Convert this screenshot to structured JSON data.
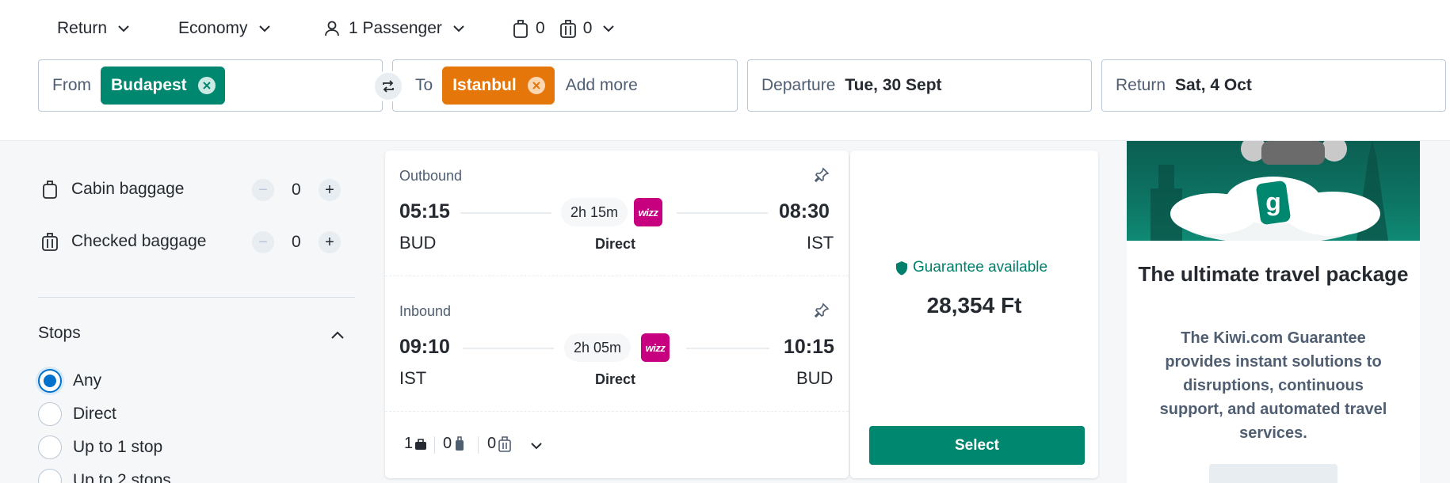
{
  "options": {
    "trip_type": "Return",
    "cabin_class": "Economy",
    "passengers": "1 Passenger",
    "cabin_bags": "0",
    "checked_bags": "0"
  },
  "search": {
    "from_label": "From",
    "from_value": "Budapest",
    "to_label": "To",
    "to_value": "Istanbul",
    "add_more": "Add more",
    "departure_label": "Departure",
    "departure_value": "Tue, 30 Sept",
    "return_label": "Return",
    "return_value": "Sat, 4 Oct"
  },
  "sidebar": {
    "cabin_baggage_label": "Cabin baggage",
    "cabin_baggage_count": "0",
    "checked_baggage_label": "Checked baggage",
    "checked_baggage_count": "0",
    "stops_title": "Stops",
    "stops_options": [
      "Any",
      "Direct",
      "Up to 1 stop",
      "Up to 2 stops"
    ],
    "stops_selected": "Any"
  },
  "result": {
    "outbound": {
      "label": "Outbound",
      "depart_time": "05:15",
      "arrive_time": "08:30",
      "duration": "2h 15m",
      "from_code": "BUD",
      "to_code": "IST",
      "stops": "Direct",
      "airline_logo": "wizz"
    },
    "inbound": {
      "label": "Inbound",
      "depart_time": "09:10",
      "arrive_time": "10:15",
      "duration": "2h 05m",
      "from_code": "IST",
      "to_code": "BUD",
      "stops": "Direct",
      "airline_logo": "wizz"
    },
    "baggage": {
      "personal_item": "1",
      "cabin_bag": "0",
      "checked_bag": "0"
    },
    "guarantee": "Guarantee available",
    "price": "28,354 Ft",
    "select_label": "Select"
  },
  "promo": {
    "title": "The ultimate travel package",
    "body": "The Kiwi.com Guarantee provides instant solutions to disruptions, continuous support, and automated travel services."
  },
  "colors": {
    "from_chip": "#00876f",
    "to_chip": "#e5760a",
    "primary_green": "#00876f",
    "selected_radio": "#0172cb",
    "wizz_brand": "#c6007e"
  }
}
